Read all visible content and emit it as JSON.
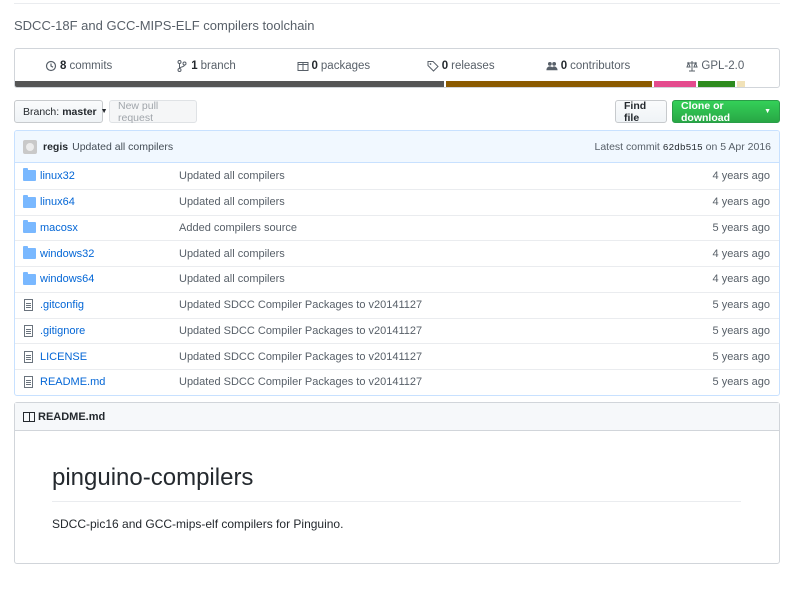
{
  "repo": {
    "description": "SDCC-18F and GCC-MIPS-ELF compilers toolchain"
  },
  "summary": {
    "commits": {
      "count": "8",
      "label": "commits"
    },
    "branches": {
      "count": "1",
      "label": "branch"
    },
    "packages": {
      "count": "0",
      "label": "packages"
    },
    "releases": {
      "count": "0",
      "label": "releases"
    },
    "contributors": {
      "count": "0",
      "label": "contributors"
    },
    "license": "GPL-2.0"
  },
  "language_bar": [
    {
      "color": "#555555",
      "share": 0.567
    },
    {
      "color": "#8b5a00",
      "share": 0.273
    },
    {
      "color": "#e44b8d",
      "share": 0.055
    },
    {
      "color": "#2e8b1f",
      "share": 0.05
    },
    {
      "color": "#f1e2b8",
      "share": 0.01
    }
  ],
  "toolbar": {
    "branch_label": "Branch:",
    "branch_value": "master",
    "new_pull_request": "New pull request",
    "find_file": "Find file",
    "clone_download": "Clone or download"
  },
  "latest_commit": {
    "author": "regis",
    "message": "Updated all compilers",
    "prefix": "Latest commit",
    "sha": "62db515",
    "date": "on 5 Apr 2016"
  },
  "files": [
    {
      "type": "dir",
      "name": "linux32",
      "message": "Updated all compilers",
      "age": "4 years ago"
    },
    {
      "type": "dir",
      "name": "linux64",
      "message": "Updated all compilers",
      "age": "4 years ago"
    },
    {
      "type": "dir",
      "name": "macosx",
      "message": "Added compilers source",
      "age": "5 years ago"
    },
    {
      "type": "dir",
      "name": "windows32",
      "message": "Updated all compilers",
      "age": "4 years ago"
    },
    {
      "type": "dir",
      "name": "windows64",
      "message": "Updated all compilers",
      "age": "4 years ago"
    },
    {
      "type": "file",
      "name": ".gitconfig",
      "message": "Updated SDCC Compiler Packages to v20141127",
      "age": "5 years ago"
    },
    {
      "type": "file",
      "name": ".gitignore",
      "message": "Updated SDCC Compiler Packages to v20141127",
      "age": "5 years ago"
    },
    {
      "type": "file",
      "name": "LICENSE",
      "message": "Updated SDCC Compiler Packages to v20141127",
      "age": "5 years ago"
    },
    {
      "type": "file",
      "name": "README.md",
      "message": "Updated SDCC Compiler Packages to v20141127",
      "age": "5 years ago"
    }
  ],
  "readme": {
    "header": "README.md",
    "title": "pinguino-compilers",
    "text": "SDCC-pic16 and GCC-mips-elf compilers for Pinguino."
  }
}
